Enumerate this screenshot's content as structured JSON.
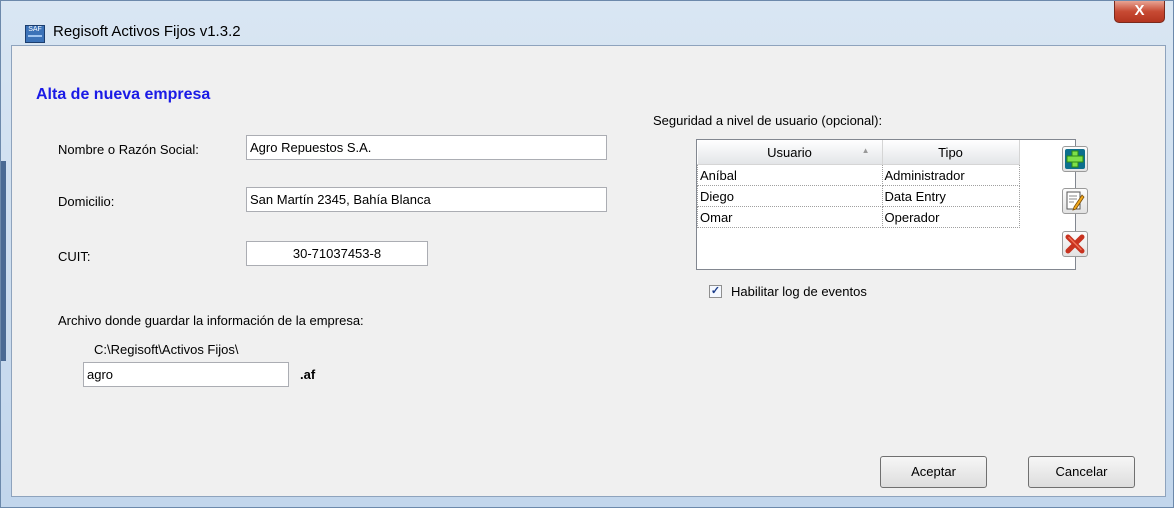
{
  "window": {
    "title": "Regisoft Activos Fijos v1.3.2",
    "close_label": "X",
    "app_icon_text": "SAF"
  },
  "form": {
    "heading": "Alta de nueva empresa",
    "nombre_label": "Nombre o Razón Social:",
    "nombre_value": "Agro Repuestos S.A.",
    "domicilio_label": "Domicilio:",
    "domicilio_value": "San Martín 2345, Bahía Blanca",
    "cuit_label": "CUIT:",
    "cuit_value": "30-71037453-8",
    "archivo_label": "Archivo donde guardar la información de la empresa:",
    "archivo_path": "C:\\Regisoft\\Activos Fijos\\",
    "archivo_name": "agro",
    "archivo_ext": ".af"
  },
  "security": {
    "label": "Seguridad a nivel de usuario (opcional):",
    "columns": [
      "Usuario",
      "Tipo"
    ],
    "rows": [
      {
        "usuario": "Aníbal",
        "tipo": "Administrador"
      },
      {
        "usuario": "Diego",
        "tipo": "Data Entry"
      },
      {
        "usuario": "Omar",
        "tipo": "Operador"
      }
    ],
    "log_label": "Habilitar log de eventos",
    "log_checked": true,
    "add_icon": "add-icon",
    "edit_icon": "edit-icon",
    "delete_icon": "delete-icon"
  },
  "buttons": {
    "aceptar": "Aceptar",
    "cancelar": "Cancelar"
  }
}
